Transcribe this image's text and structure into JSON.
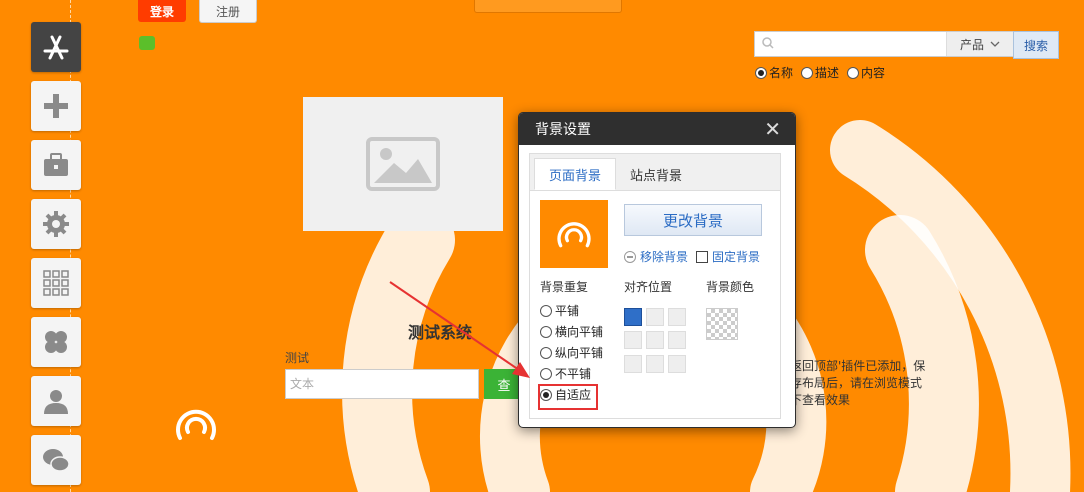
{
  "header": {
    "login_label": "登录",
    "register_label": "注册"
  },
  "search": {
    "placeholder": "",
    "category_selected": "产品",
    "button_label": "搜索",
    "options": [
      {
        "label": "名称",
        "selected": true
      },
      {
        "label": "描述",
        "selected": false
      },
      {
        "label": "内容",
        "selected": false
      }
    ]
  },
  "sidebar": {
    "items": [
      {
        "icon": "app-store-icon",
        "active": true
      },
      {
        "icon": "plus-icon",
        "active": false
      },
      {
        "icon": "toolbox-icon",
        "active": false
      },
      {
        "icon": "gear-icon",
        "active": false
      },
      {
        "icon": "grid-icon",
        "active": false
      },
      {
        "icon": "clover-icon",
        "active": false
      },
      {
        "icon": "user-icon",
        "active": false
      },
      {
        "icon": "wechat-icon",
        "active": false
      }
    ]
  },
  "main": {
    "system_title": "测试系统",
    "field_label": "测试",
    "input_placeholder": "文本",
    "query_button": "查",
    "notice": "返回顶部'插件已添加，保存布局后，请在浏览模式下查看效果"
  },
  "dialog": {
    "title": "背景设置",
    "tabs": [
      "页面背景",
      "站点背景"
    ],
    "change_bg_button": "更改背景",
    "remove_bg_label": "移除背景",
    "fixed_bg_label": "固定背景",
    "fixed_bg_checked": false,
    "repeat_label": "背景重复",
    "align_label": "对齐位置",
    "color_label": "背景颜色",
    "repeat_options": [
      {
        "label": "平铺",
        "selected": false
      },
      {
        "label": "横向平铺",
        "selected": false
      },
      {
        "label": "纵向平铺",
        "selected": false
      },
      {
        "label": "不平铺",
        "selected": false
      },
      {
        "label": "自适应",
        "selected": true
      }
    ],
    "align_selected": "top-left"
  },
  "colors": {
    "page_background": "#ff8a00",
    "login_button": "#ff3c00",
    "query_button": "#3bb336",
    "dialog_header": "#2f2f2f",
    "link_blue": "#2b6cc4",
    "highlight_red": "#e63232"
  }
}
